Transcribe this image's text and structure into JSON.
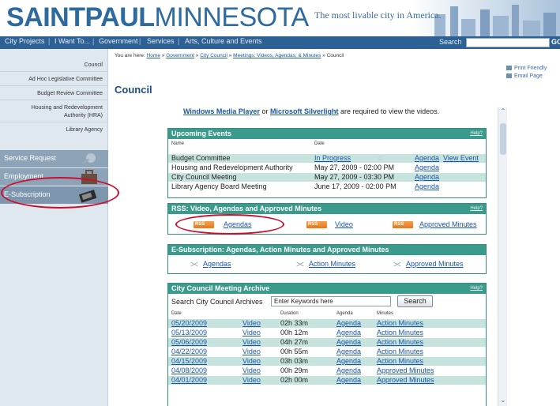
{
  "header": {
    "logo_part1": "SAINTPAUL",
    "logo_part2": "MINNESOTA",
    "tagline": "The most livable city in America."
  },
  "nav": {
    "items": [
      "City Projects",
      "I Want To...",
      "Government",
      "Services",
      "Arts, Culture and Events"
    ],
    "search_label": "Search",
    "search_go": "GO"
  },
  "sidebar": {
    "subitems": [
      "Council",
      "Ad Hoc Legislative Committee",
      "Budget Review Committee",
      "Housing and Redevelopment",
      "Authority (HRA)",
      "Library Agency"
    ],
    "buttons": [
      "Service Request",
      "Employment",
      "E-Subscription"
    ]
  },
  "breadcrumb": {
    "prefix": "You are here:",
    "links": [
      "Home",
      "Government",
      "City Council",
      "Meetings: Videos, Agendas, & Minutes"
    ],
    "sep": "»",
    "current": "Council"
  },
  "page": {
    "title": "Council",
    "print": "Print Friendly",
    "email": "Email Page"
  },
  "player_note": {
    "link1": "Windows Media Player",
    "mid": "or",
    "link2": "Microsoft Silverlight",
    "suffix": "are required to view the videos."
  },
  "upcoming": {
    "title": "Upcoming Events",
    "help": "Help?",
    "col_name": "Name",
    "col_date": "Date",
    "rows": [
      {
        "name": "Budget Committee",
        "date": "In Progress",
        "agenda": "Agenda",
        "extra": "View Event"
      },
      {
        "name": "Housing and Redevelopment Authority",
        "date": "May 27, 2009 - 02:00 PM",
        "agenda": "Agenda",
        "extra": ""
      },
      {
        "name": "City Council Meeting",
        "date": "May 27, 2009 - 03:30 PM",
        "agenda": "Agenda",
        "extra": ""
      },
      {
        "name": "Library Agency Board Meeting",
        "date": "June 17, 2009 - 02:00 PM",
        "agenda": "Agenda",
        "extra": ""
      }
    ]
  },
  "rss": {
    "title": "RSS: Video, Agendas and Approved Minutes",
    "help": "Help?",
    "badge": "RSS",
    "links": [
      "Agendas",
      "Video",
      "Approved Minutes"
    ]
  },
  "esub": {
    "title": "E-Subscription: Agendas, Action Minutes and Approved Minutes",
    "links": [
      "Agendas",
      "Action Minutes",
      "Approved Minutes"
    ]
  },
  "archive": {
    "title": "City Council Meeting Archive",
    "help": "Help?",
    "search_label": "Search City Council Archives",
    "search_value": "Enter Keywords here",
    "search_button": "Search",
    "cols": [
      "Date",
      "Duration",
      "Agenda",
      "Minutes"
    ],
    "rows": [
      {
        "date": "05/20/2009",
        "video": "Video",
        "duration": "02h 33m",
        "agenda": "Agenda",
        "minutes": "Action Minutes"
      },
      {
        "date": "05/13/2009",
        "video": "Video",
        "duration": "00h 12m",
        "agenda": "Agenda",
        "minutes": "Action Minutes"
      },
      {
        "date": "05/06/2009",
        "video": "Video",
        "duration": "04h 27m",
        "agenda": "Agenda",
        "minutes": "Action Minutes"
      },
      {
        "date": "04/22/2009",
        "video": "Video",
        "duration": "00h 55m",
        "agenda": "Agenda",
        "minutes": "Action Minutes"
      },
      {
        "date": "04/15/2009",
        "video": "Video",
        "duration": "03h 03m",
        "agenda": "Agenda",
        "minutes": "Action Minutes"
      },
      {
        "date": "04/08/2009",
        "video": "Video",
        "duration": "00h 29m",
        "agenda": "Agenda",
        "minutes": "Approved Minutes"
      },
      {
        "date": "04/01/2009",
        "video": "Video",
        "duration": "02h 00m",
        "agenda": "Agenda",
        "minutes": "Approved Minutes"
      }
    ]
  },
  "colors": {
    "brand_blue": "#2d6aa0",
    "nav_blue": "#2d6196",
    "panel_teal": "#3a9b8c",
    "row_alt": "#c7e3dd",
    "annotation_red": "#c8102e"
  }
}
